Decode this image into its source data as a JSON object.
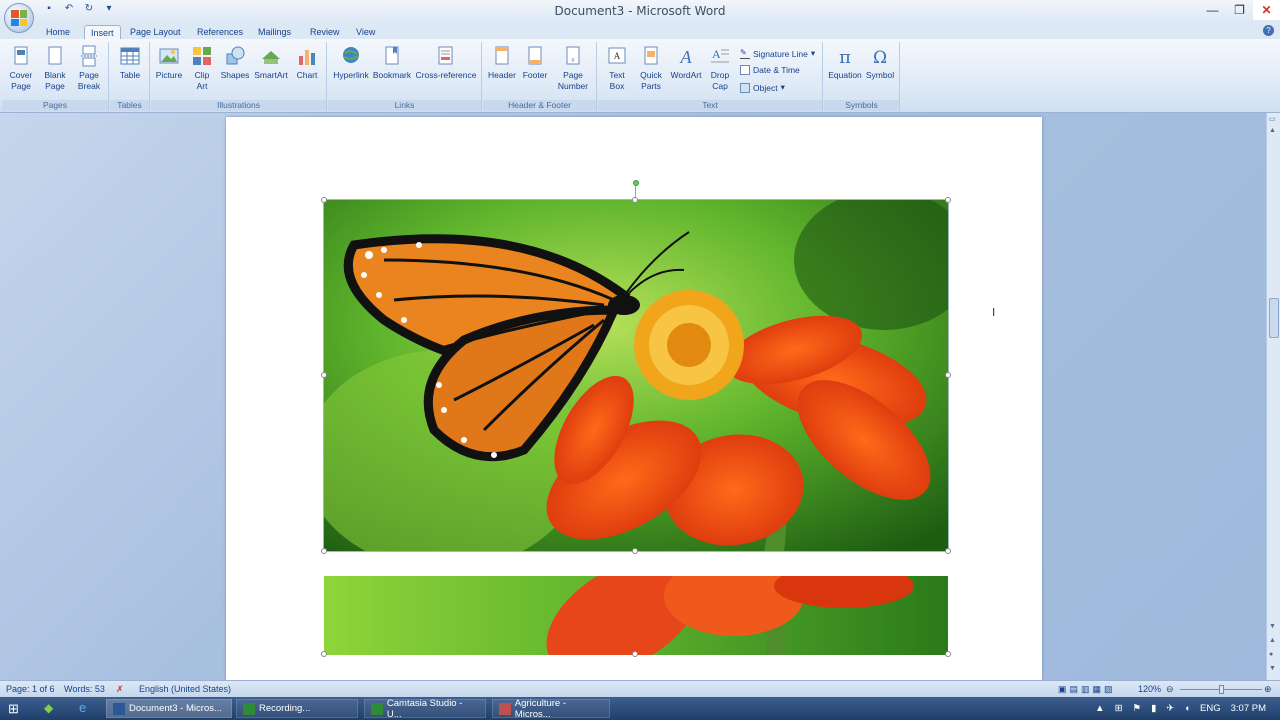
{
  "window": {
    "title": "Document3 - Microsoft Word"
  },
  "qat": {
    "save_icon": "save-icon",
    "undo_icon": "undo-icon",
    "redo_icon": "redo-icon",
    "more": "▾"
  },
  "tabs": [
    "Home",
    "Insert",
    "Page Layout",
    "References",
    "Mailings",
    "Review",
    "View"
  ],
  "active_tab": "Insert",
  "ribbon": {
    "pages": {
      "label": "Pages",
      "cover": "Cover\nPage",
      "blank": "Blank\nPage",
      "break": "Page\nBreak"
    },
    "tables": {
      "label": "Tables",
      "table": "Table"
    },
    "illustrations": {
      "label": "Illustrations",
      "picture": "Picture",
      "clipart": "Clip\nArt",
      "shapes": "Shapes",
      "smartart": "SmartArt",
      "chart": "Chart"
    },
    "links": {
      "label": "Links",
      "hyperlink": "Hyperlink",
      "bookmark": "Bookmark",
      "crossref": "Cross-reference"
    },
    "headerfooter": {
      "label": "Header & Footer",
      "header": "Header",
      "footer": "Footer",
      "pagenumber": "Page\nNumber"
    },
    "text": {
      "label": "Text",
      "textbox": "Text\nBox",
      "quickparts": "Quick\nParts",
      "wordart": "WordArt",
      "dropcap": "Drop\nCap",
      "signature": "Signature Line",
      "datetime": "Date & Time",
      "object": "Object"
    },
    "symbols": {
      "label": "Symbols",
      "equation": "Equation",
      "symbol": "Symbol"
    }
  },
  "status": {
    "page": "Page: 1 of 6",
    "words": "Words: 53",
    "language": "English (United States)",
    "zoom": "120%"
  },
  "taskbar": {
    "tasks": [
      "Document3 - Micros...",
      "Recording...",
      "Camtasia Studio - U...",
      "Agriculture - Micros..."
    ],
    "tray_lang": "ENG",
    "time": "3:07 PM"
  },
  "colors": {
    "ribbon_text": "#15428b",
    "accent": "#2b5797"
  }
}
